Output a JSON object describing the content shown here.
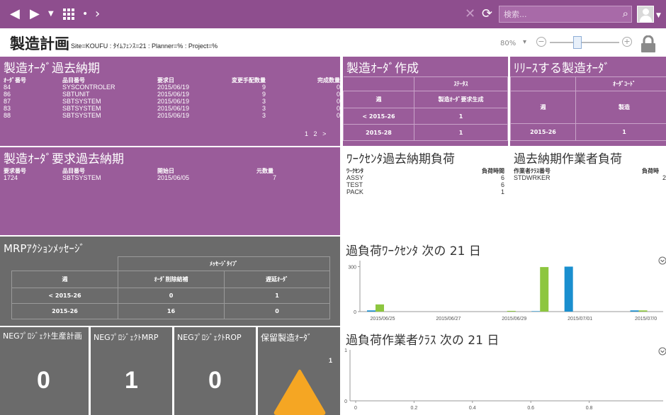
{
  "topbar": {
    "back_icon": "triangle-left-icon",
    "forward_icon": "triangle-right-icon",
    "dropdown_icon": "caret-down-icon",
    "grid_icon": "grid-icon",
    "dot_icon": "dot-icon",
    "breadcrumb_next_icon": "chevron-right-icon",
    "close_icon": "x-icon",
    "refresh_icon": "refresh-icon",
    "search_placeholder": "検索...",
    "search_icon": "magnifier-icon",
    "avatar_menu_icon": "caret-down-icon"
  },
  "header": {
    "title": "製造計画",
    "subtitle": "Site=KOUFU : ﾀｲﾑﾌｪﾝｽ=21 : Planner=% : Project=%",
    "zoom_level": "80%",
    "zoom_value": 0.4
  },
  "past_due_orders": {
    "title": "製造ｵｰﾀﾞ過去納期",
    "columns": [
      "ｵｰﾀﾞ番号",
      "品目番号",
      "要求日",
      "変更手配数量",
      "完成数量"
    ],
    "rows": [
      [
        "84",
        "SYSCONTROLER",
        "2015/06/19",
        "9",
        "0"
      ],
      [
        "86",
        "SBTUNIT",
        "2015/06/19",
        "9",
        "0"
      ],
      [
        "87",
        "SBTSYSTEM",
        "2015/06/19",
        "3",
        "0"
      ],
      [
        "83",
        "SBTSYSTEM",
        "2015/06/19",
        "3",
        "0"
      ],
      [
        "88",
        "SBTSYSTEM",
        "2015/06/19",
        "3",
        "0"
      ]
    ],
    "pager": [
      "1",
      "2",
      ">"
    ]
  },
  "create_orders": {
    "title": "製造ｵｰﾀﾞ作成",
    "status_header": "ｽﾃｰﾀｽ",
    "col_week": "週",
    "col_status": "製造ｵｰﾀﾞ要求生成",
    "rows": [
      [
        "< 2015-26",
        "1"
      ],
      [
        "2015-28",
        "1"
      ]
    ]
  },
  "release_orders": {
    "title": "ﾘﾘｰｽする製造ｵｰﾀﾞ",
    "code_header": "ｵｰﾀﾞｺｰﾄﾞ",
    "col_week": "週",
    "col_code": "製造",
    "rows": [
      [
        "2015-26",
        "1"
      ]
    ]
  },
  "past_due_requests": {
    "title": "製造ｵｰﾀﾞ要求過去納期",
    "columns": [
      "要求番号",
      "品目番号",
      "開始日",
      "元数量"
    ],
    "rows": [
      [
        "1724",
        "SBTSYSTEM",
        "2015/06/05",
        "7"
      ]
    ]
  },
  "wc_past_due": {
    "title": "ﾜｰｸｾﾝﾀ過去納期負荷",
    "columns": [
      "ﾜｰｸｾﾝﾀ",
      "負荷時間"
    ],
    "rows": [
      [
        "ASSY",
        "6"
      ],
      [
        "TEST",
        "6"
      ],
      [
        "PACK",
        "1"
      ]
    ]
  },
  "worker_past_due": {
    "title": "過去納期作業者負荷",
    "columns": [
      "作業者ｸﾗｽ番号",
      "負荷時"
    ],
    "rows": [
      [
        "STDWRKER",
        "2"
      ]
    ]
  },
  "mrp_messages": {
    "title": "MRPｱｸｼｮﾝﾒｯｾｰｼﾞ",
    "type_header": "ﾒｯｾｰｼﾞﾀｲﾌﾟ",
    "col_week": "週",
    "col_delete": "ｵｰﾀﾞ削除結補",
    "col_delay": "遅延ｵｰﾀﾞ",
    "rows": [
      [
        "< 2015-26",
        "0",
        "1"
      ],
      [
        "2015-26",
        "16",
        "0"
      ]
    ]
  },
  "neg_tiles": [
    {
      "title": "NEGﾌﾟﾛｼﾞｪｸﾄ生産計画",
      "value": "0"
    },
    {
      "title": "NEGﾌﾟﾛｼﾞｪｸﾄMRP",
      "value": "1"
    },
    {
      "title": "NEGﾌﾟﾛｼﾞｪｸﾄROP",
      "value": "0"
    }
  ],
  "hold_orders": {
    "title": "保留製造ｵｰﾀﾞ",
    "count": "1",
    "icon": "warning-triangle-icon"
  },
  "colors": {
    "purple": "#9a5c9a",
    "grey": "#6b6b6b",
    "blue": "#1a8fcf",
    "green": "#8dc63f",
    "yellow": "#f5a623"
  },
  "chart_data": [
    {
      "type": "bar",
      "title": "過負荷ﾜｰｸｾﾝﾀ 次の 21 日",
      "xlabel": "",
      "ylabel": "",
      "ylim": [
        0,
        340
      ],
      "yticks": [
        0,
        300
      ],
      "x_tick_labels": [
        "2015/06/25",
        "2015/06/27",
        "2015/06/29",
        "2015/07/01",
        "2015/07/0"
      ],
      "categories": [
        "2015/06/25",
        "2015/06/26",
        "2015/06/27",
        "2015/06/28",
        "2015/06/29",
        "2015/06/30",
        "2015/07/01",
        "2015/07/02",
        "2015/07/03"
      ],
      "series": [
        {
          "color": "#1a8fcf",
          "values": [
            8,
            0,
            0,
            0,
            0,
            3,
            300,
            0,
            8
          ]
        },
        {
          "color": "#8dc63f",
          "values": [
            48,
            0,
            0,
            0,
            5,
            297,
            0,
            0,
            8
          ]
        }
      ]
    },
    {
      "type": "bar",
      "title": "過負荷作業者ｸﾗｽ 次の 21 日",
      "xlabel": "",
      "ylabel": "",
      "ylim": [
        0,
        1
      ],
      "yticks": [
        0,
        1
      ],
      "x_tick_labels": [
        "0",
        "0.2",
        "0.4",
        "0.6",
        "0.8"
      ],
      "xlim": [
        0,
        1
      ],
      "series": []
    }
  ]
}
